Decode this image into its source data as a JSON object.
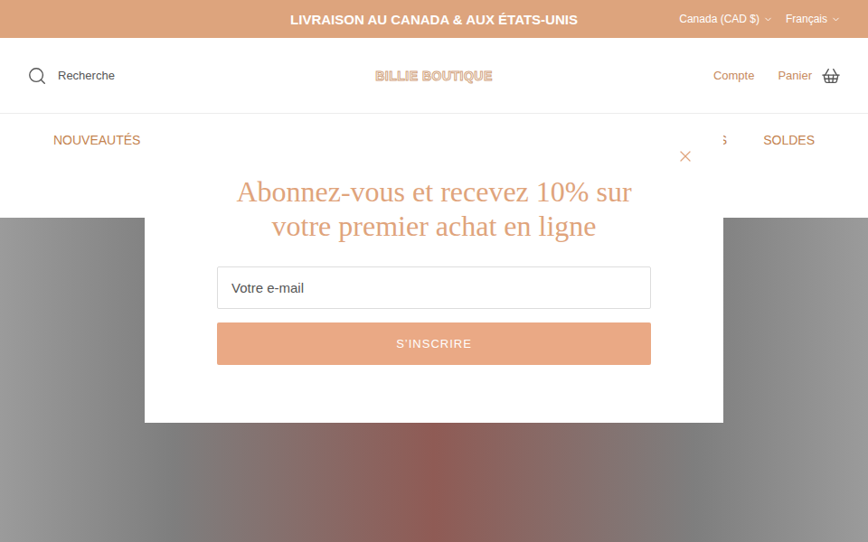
{
  "announcement": {
    "text": "LIVRAISON AU CANADA & AUX ÉTATS-UNIS"
  },
  "selectors": [
    {
      "label": "Canada (CAD $)"
    },
    {
      "label": "Français"
    }
  ],
  "header": {
    "search": "Recherche",
    "logo": "BILLIE BOUTIQUE",
    "account": "Compte",
    "cart": "Panier"
  },
  "nav": [
    {
      "label": "NOUVEAUTÉS"
    },
    {
      "label": "ES"
    },
    {
      "label": "SOLDES"
    }
  ],
  "modal": {
    "title": "Abonnez-vous et recevez 10% sur votre premier achat en ligne",
    "email_placeholder": "Votre e-mail",
    "submit": "S’INSCRIRE"
  }
}
